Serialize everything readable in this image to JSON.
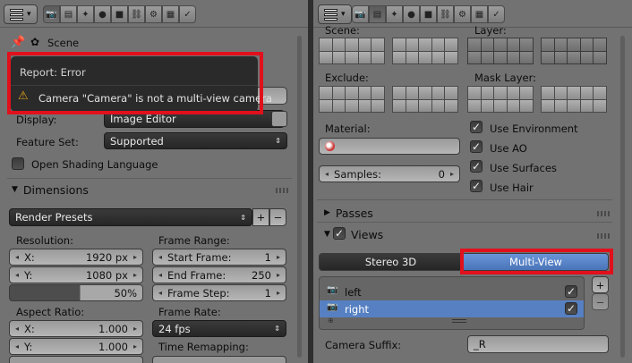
{
  "left": {
    "scene_label": "Scene",
    "report_title": "Report: Error",
    "report_message": "Camera \"Camera\" is not a multi-view camera",
    "display_label": "Display:",
    "display_value": "Image Editor",
    "feature_label": "Feature Set:",
    "feature_value": "Supported",
    "osl_label": "Open Shading Language",
    "dimensions_title": "Dimensions",
    "presets_value": "Render Presets",
    "resolution_label": "Resolution:",
    "res_x_label": "X:",
    "res_x_value": "1920 px",
    "res_y_label": "Y:",
    "res_y_value": "1080 px",
    "res_pct": "50%",
    "frame_range_label": "Frame Range:",
    "start_label": "Start Frame:",
    "start_value": "1",
    "end_label": "End Frame:",
    "end_value": "250",
    "step_label": "Frame Step:",
    "step_value": "1",
    "aspect_label": "Aspect Ratio:",
    "asp_x_label": "X:",
    "asp_x_value": "1.000",
    "asp_y_label": "Y:",
    "asp_y_value": "1.000",
    "frame_rate_label": "Frame Rate:",
    "fps_value": "24 fps",
    "time_remap_label": "Time Remapping:"
  },
  "right": {
    "scene_label": "Scene:",
    "layer_label": "Layer:",
    "exclude_label": "Exclude:",
    "mask_label": "Mask Layer:",
    "material_label": "Material:",
    "samples_label": "Samples:",
    "samples_value": "0",
    "use_environment": "Use Environment",
    "use_ao": "Use AO",
    "use_surfaces": "Use Surfaces",
    "use_hair": "Use Hair",
    "passes_title": "Passes",
    "views_title": "Views",
    "stereo_label": "Stereo 3D",
    "multiview_label": "Multi-View",
    "views": [
      {
        "name": "left"
      },
      {
        "name": "right"
      }
    ],
    "camera_suffix_label": "Camera Suffix:",
    "camera_suffix_value": "_R"
  },
  "colors": {
    "highlight": "#e0101c",
    "selected": "#5680c2"
  }
}
